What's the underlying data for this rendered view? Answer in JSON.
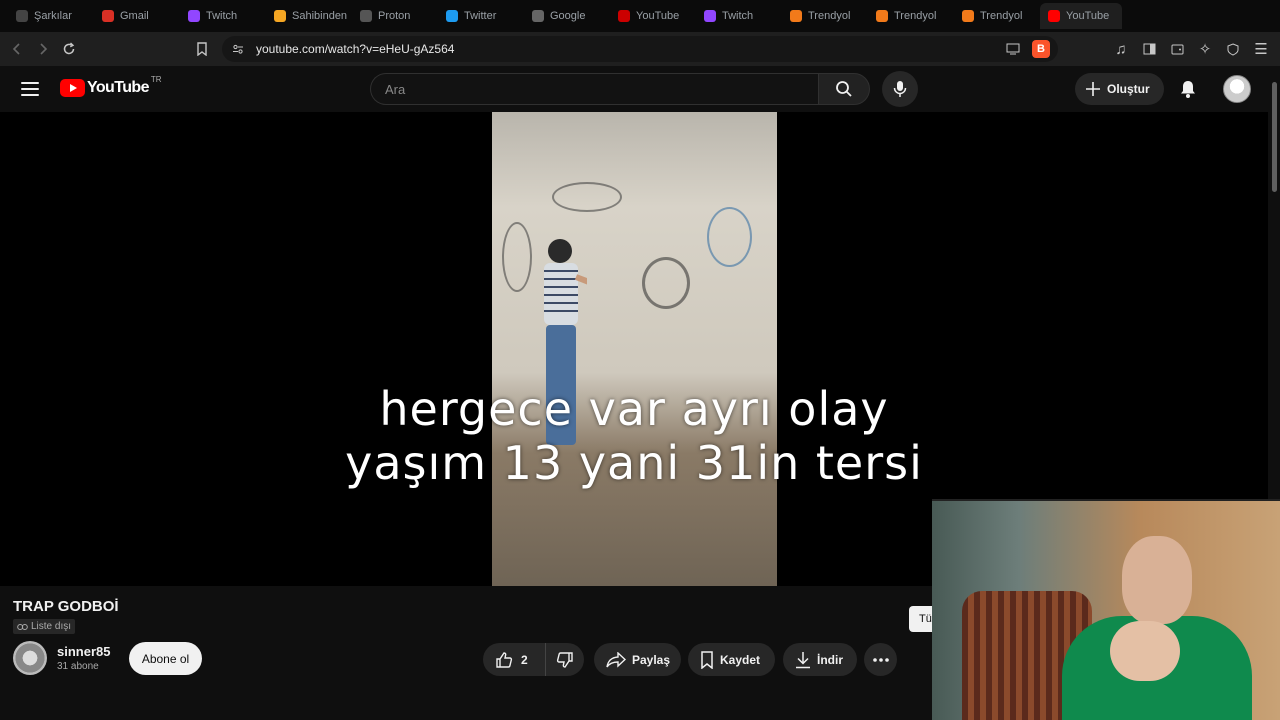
{
  "browser": {
    "tabs": [
      {
        "label": "Şarkılar",
        "color": "#444"
      },
      {
        "label": "Gmail",
        "color": "#d93025"
      },
      {
        "label": "Twitch",
        "color": "#9146ff"
      },
      {
        "label": "Sahibinden",
        "color": "#f5a623"
      },
      {
        "label": "Proton",
        "color": "#555"
      },
      {
        "label": "Twitter",
        "color": "#1d9bf0"
      },
      {
        "label": "Google",
        "color": "#666"
      },
      {
        "label": "YouTube",
        "color": "#c00"
      },
      {
        "label": "Twitch",
        "color": "#9146ff"
      },
      {
        "label": "Trendyol",
        "color": "#f27a1a"
      },
      {
        "label": "Trendyol",
        "color": "#f27a1a"
      },
      {
        "label": "Trendyol",
        "color": "#f27a1a"
      },
      {
        "label": "YouTube",
        "color": "#ff0000"
      }
    ],
    "url": "youtube.com/watch?v=eHeU-gAz564"
  },
  "header": {
    "logo_text": "YouTube",
    "country": "TR",
    "search_placeholder": "Ara",
    "create_label": "Oluştur"
  },
  "video": {
    "caption_line1": "hergece var ayrı olay",
    "caption_line2": "yaşım 13 yani 31in tersi",
    "title": "TRAP GODBOİ",
    "visibility": "Liste dışı",
    "channel": "sinner85",
    "subscribers": "31 abone",
    "subscribe_label": "Abone ol",
    "likes": "2",
    "share_label": "Paylaş",
    "save_label": "Kaydet",
    "download_label": "İndir",
    "side_tag": "Tü"
  },
  "colors": {
    "background": "#0f0f0f",
    "brand_red": "#ff0000",
    "chip": "#272727"
  }
}
